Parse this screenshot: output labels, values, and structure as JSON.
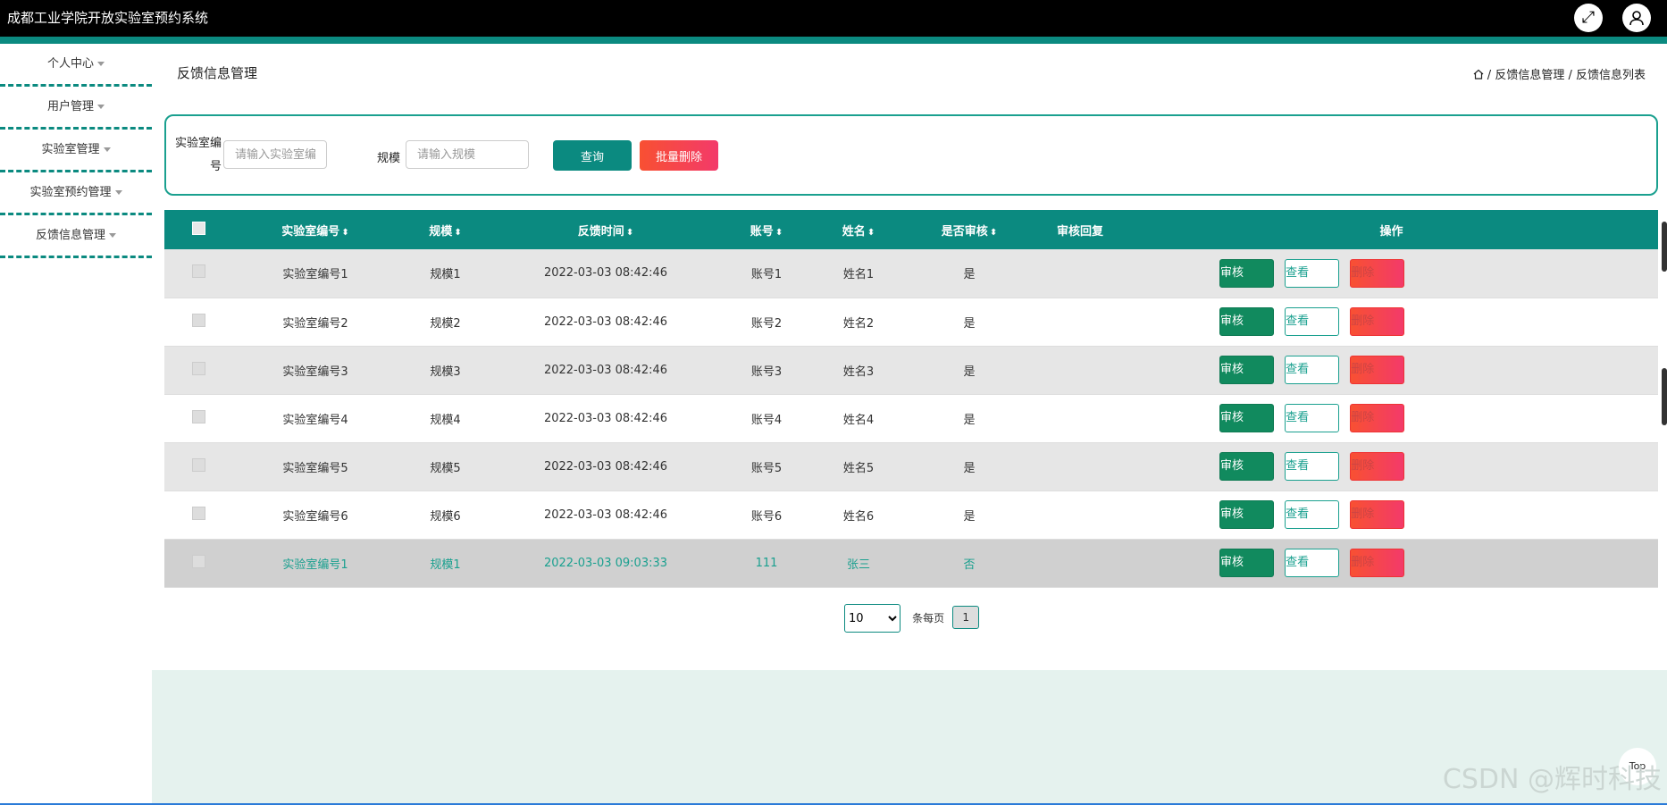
{
  "app": {
    "title": "成都工业学院开放实验室预约系统"
  },
  "topbar": {
    "fullscreen_icon": "expand-icon",
    "user_icon": "user-icon"
  },
  "sidebar": {
    "items": [
      {
        "label": "个人中心"
      },
      {
        "label": "用户管理"
      },
      {
        "label": "实验室管理"
      },
      {
        "label": "实验室预约管理"
      },
      {
        "label": "反馈信息管理"
      }
    ]
  },
  "page": {
    "title": "反馈信息管理",
    "breadcrumb": {
      "level1": "反馈信息管理",
      "level2": "反馈信息列表"
    }
  },
  "search": {
    "lab_label_line1": "实验室编",
    "lab_label_line2": "号",
    "lab_placeholder": "请输入实验室编号",
    "scale_label": "规模",
    "scale_placeholder": "请输入规模",
    "query_label": "查询",
    "batch_delete_label": "批量删除"
  },
  "table": {
    "headers": [
      "实验室编号",
      "规模",
      "反馈时间",
      "账号",
      "姓名",
      "是否审核",
      "审核回复",
      "操作"
    ],
    "rows": [
      {
        "lab": "实验室编号1",
        "scale": "规模1",
        "time": "2022-03-03 08:42:46",
        "account": "账号1",
        "name": "姓名1",
        "audited": "是",
        "reply": ""
      },
      {
        "lab": "实验室编号2",
        "scale": "规模2",
        "time": "2022-03-03 08:42:46",
        "account": "账号2",
        "name": "姓名2",
        "audited": "是",
        "reply": ""
      },
      {
        "lab": "实验室编号3",
        "scale": "规模3",
        "time": "2022-03-03 08:42:46",
        "account": "账号3",
        "name": "姓名3",
        "audited": "是",
        "reply": ""
      },
      {
        "lab": "实验室编号4",
        "scale": "规模4",
        "time": "2022-03-03 08:42:46",
        "account": "账号4",
        "name": "姓名4",
        "audited": "是",
        "reply": ""
      },
      {
        "lab": "实验室编号5",
        "scale": "规模5",
        "time": "2022-03-03 08:42:46",
        "account": "账号5",
        "name": "姓名5",
        "audited": "是",
        "reply": ""
      },
      {
        "lab": "实验室编号6",
        "scale": "规模6",
        "time": "2022-03-03 08:42:46",
        "account": "账号6",
        "name": "姓名6",
        "audited": "是",
        "reply": ""
      },
      {
        "lab": "实验室编号1",
        "scale": "规模1",
        "time": "2022-03-03 09:03:33",
        "account": "111",
        "name": "张三",
        "audited": "否",
        "reply": ""
      }
    ],
    "actions": {
      "audit": "审核",
      "view": "查看",
      "delete": "删除"
    }
  },
  "pager": {
    "page_size": "10",
    "per_page_label": "条每页",
    "current_page": "1"
  },
  "watermark": "CSDN @辉时科技",
  "top_button": "Top",
  "colors": {
    "accent": "#0b8a80",
    "danger": "#f33a6a",
    "audit": "#118a5e"
  }
}
